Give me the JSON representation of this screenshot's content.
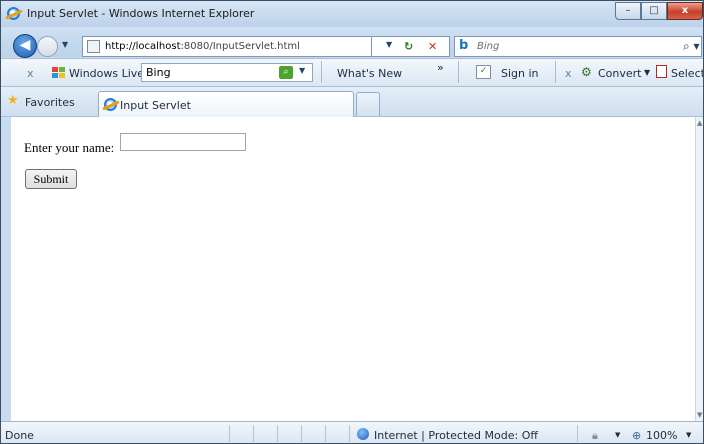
{
  "window": {
    "title": "Input Servlet - Windows Internet Explorer",
    "controls": {
      "minimize": "–",
      "maximize": "□",
      "close": "x"
    }
  },
  "address_bar": {
    "url_host": "http://localhost",
    "url_rest": ":8080/InputServlet.html",
    "search_placeholder": "Bing"
  },
  "toolbar": {
    "close_glyph": "x",
    "windows_live_label": "Windows Live",
    "search_value": "Bing",
    "whats_new_label": "What's New",
    "chevron": "»",
    "sign_in_label": "Sign in",
    "close2_glyph": "x",
    "convert_label": "Convert",
    "select_label": "Select"
  },
  "favorites_bar": {
    "favorites_label": "Favorites",
    "tab_title": "Input Servlet"
  },
  "page": {
    "name_label": "Enter your name:",
    "name_value": "",
    "submit_label": "Submit"
  },
  "status_bar": {
    "status_text": "Done",
    "zone_text": "Internet | Protected Mode: Off",
    "zoom_text": "100%"
  },
  "colors": {
    "chrome_blue": "#c9dbee",
    "close_red": "#c5412a",
    "bing_blue": "#1a78c2"
  }
}
